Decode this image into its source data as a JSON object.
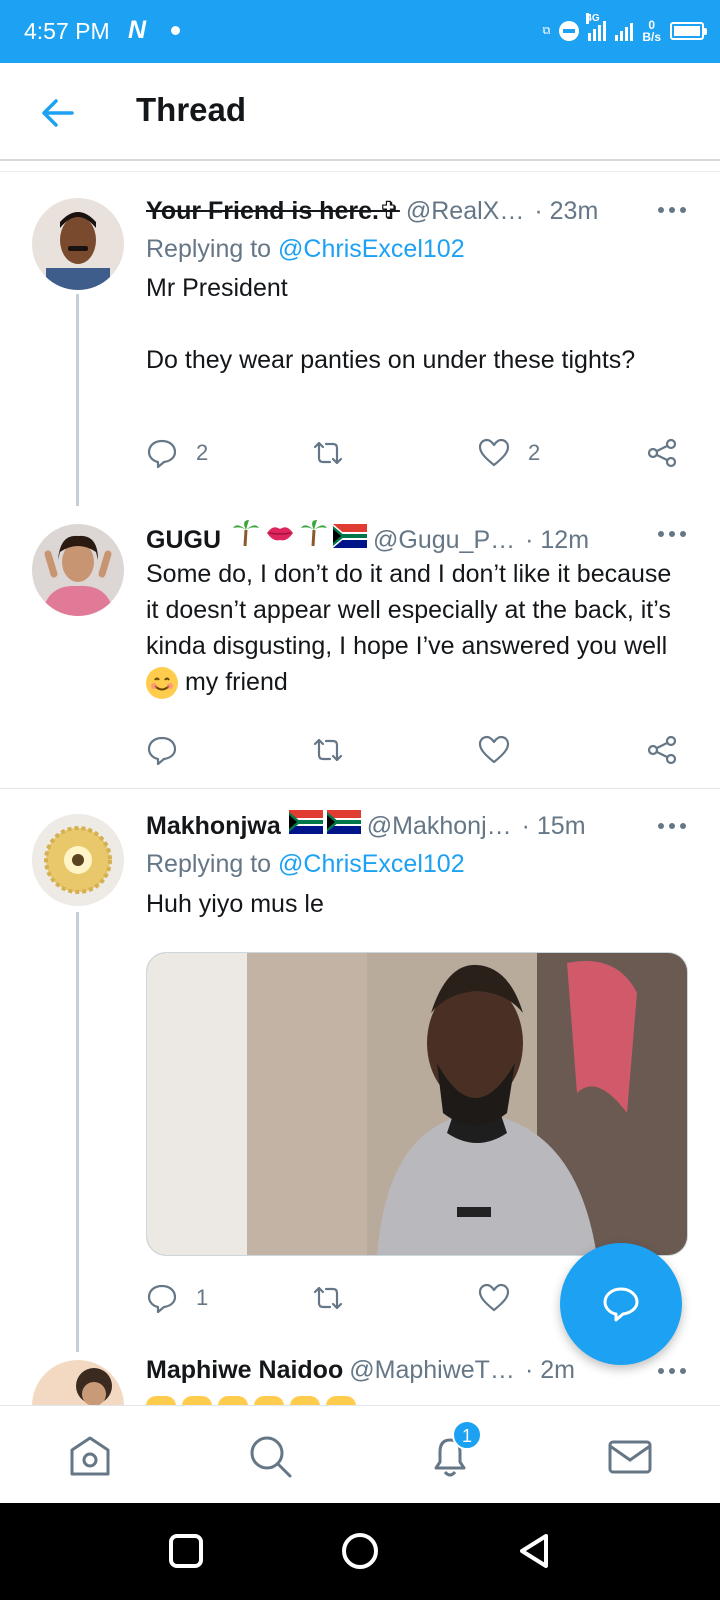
{
  "status_bar": {
    "time": "4:57 PM",
    "app_letter": "N",
    "network": "4G",
    "speed_value": "0",
    "speed_unit": "B/s"
  },
  "header": {
    "title": "Thread"
  },
  "tweets": [
    {
      "name": "Your Friend is here.✞",
      "handle": "@RealX…",
      "time": "· 23m",
      "replying_prefix": "Replying to",
      "replying_to": "@ChrisExcel102",
      "text": "Mr President\n\nDo they wear panties on under these tights?",
      "replies": "2",
      "retweets": "",
      "likes": "2"
    },
    {
      "name": "GUGU",
      "handle": "@Gugu_P…",
      "time": "· 12m",
      "text_before_emoji": "Some do, I don’t do it and I don’t like it because it doesn’t appear well especially at the back, it’s kinda disgusting, I hope I’ve answered you well",
      "text_after_emoji": " my friend",
      "replies": "",
      "retweets": "",
      "likes": ""
    },
    {
      "name": "Makhonjwa",
      "handle": "@Makhonj…",
      "time": "· 15m",
      "replying_prefix": "Replying to",
      "replying_to": "@ChrisExcel102",
      "text": "Huh yiyo mus le",
      "replies": "1",
      "retweets": "",
      "likes": ""
    },
    {
      "name": "Maphiwe Naidoo",
      "handle": "@MaphiweT…",
      "time": "· 2m"
    }
  ],
  "bottom_nav": {
    "notifications_badge": "1"
  },
  "colors": {
    "brand": "#1da1f2",
    "secondary_text": "#657786",
    "primary_text": "#14171a"
  },
  "icons": [
    "back-arrow-icon",
    "more-icon",
    "reply-icon",
    "retweet-icon",
    "like-icon",
    "share-icon",
    "compose-icon",
    "home-icon",
    "search-icon",
    "bell-icon",
    "mail-icon"
  ]
}
